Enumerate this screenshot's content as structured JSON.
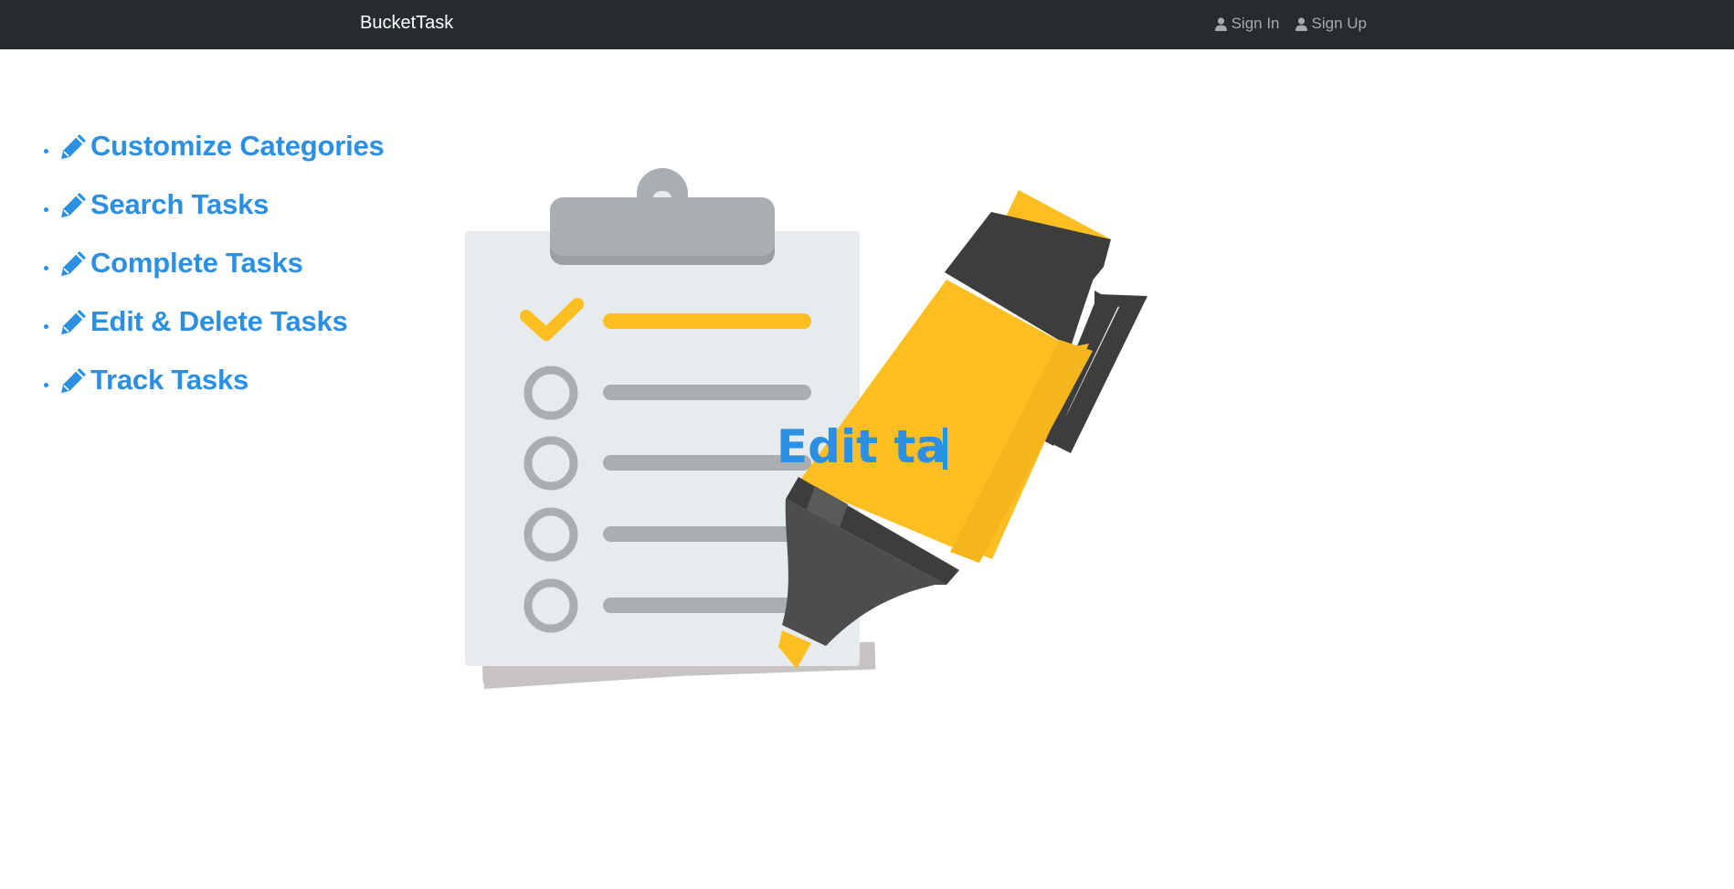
{
  "navbar": {
    "brand": "BucketTask",
    "links": [
      {
        "label": "Sign In",
        "icon": "user-icon"
      },
      {
        "label": "Sign Up",
        "icon": "user-icon"
      }
    ]
  },
  "features": [
    {
      "label": "Customize Categories",
      "icon": "pencil-icon"
    },
    {
      "label": "Search Tasks",
      "icon": "pencil-icon"
    },
    {
      "label": "Complete Tasks",
      "icon": "pencil-icon"
    },
    {
      "label": "Edit & Delete Tasks",
      "icon": "pencil-icon"
    },
    {
      "label": "Track Tasks",
      "icon": "pencil-icon"
    }
  ],
  "hero": {
    "typing_text": "Edit ta"
  },
  "colors": {
    "navbar_bg": "#272b30",
    "accent_blue": "#2b8fe2",
    "highlighter_yellow": "#fdbe22",
    "dark_gray": "#3d3d3d",
    "clipboard_bg": "#e6ecee",
    "clip_gray": "#a9aeb2"
  }
}
